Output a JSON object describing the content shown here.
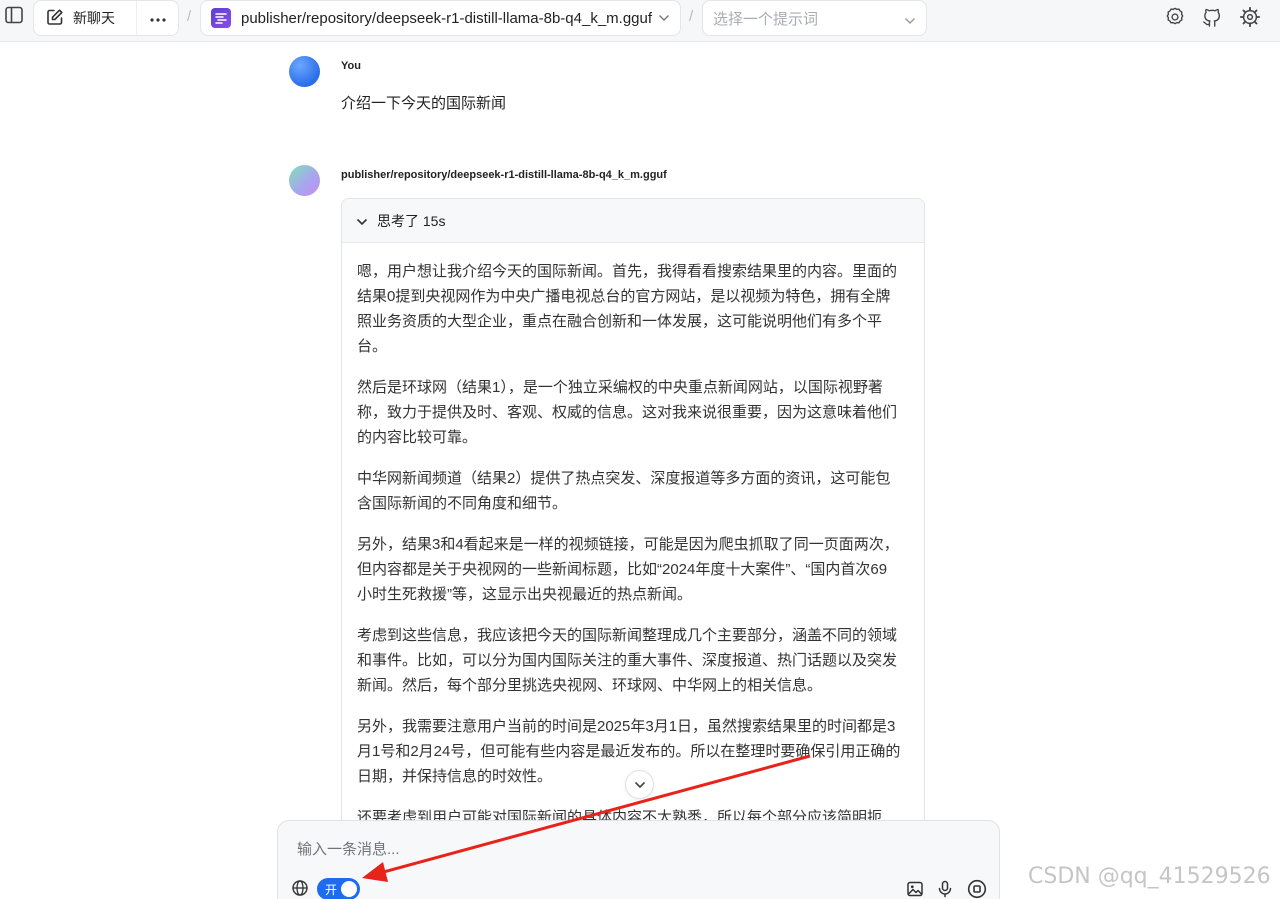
{
  "topbar": {
    "new_chat_label": "新聊天",
    "model_name": "publisher/repository/deepseek-r1-distill-llama-8b-q4_k_m.gguf",
    "prompt_placeholder": "选择一个提示词"
  },
  "icons": {
    "sidebar": "sidebar-toggle-icon",
    "new_chat": "edit-icon",
    "more": "more-horizontal-icon",
    "model": "model-logo-icon",
    "settings_a": "settings-gear-icon",
    "github": "github-icon",
    "settings_b": "settings-cog-icon"
  },
  "messages": {
    "user": {
      "sender": "You",
      "text": "介绍一下今天的国际新闻"
    },
    "assistant": {
      "sender": "publisher/repository/deepseek-r1-distill-llama-8b-q4_k_m.gguf",
      "thinking_label": "思考了 15s",
      "thinking_paragraphs": [
        "嗯，用户想让我介绍今天的国际新闻。首先，我得看看搜索结果里的内容。里面的结果0提到央视网作为中央广播电视总台的官方网站，是以视频为特色，拥有全牌照业务资质的大型企业，重点在融合创新和一体发展，这可能说明他们有多个平台。",
        "然后是环球网（结果1），是一个独立采编权的中央重点新闻网站，以国际视野著称，致力于提供及时、客观、权威的信息。这对我来说很重要，因为这意味着他们的内容比较可靠。",
        "中华网新闻频道（结果2）提供了热点突发、深度报道等多方面的资讯，这可能包含国际新闻的不同角度和细节。",
        "另外，结果3和4看起来是一样的视频链接，可能是因为爬虫抓取了同一页面两次，但内容都是关于央视网的一些新闻标题，比如“2024年度十大案件”、“国内首次69小时生死救援”等，这显示出央视最近的热点新闻。",
        "考虑到这些信息，我应该把今天的国际新闻整理成几个主要部分，涵盖不同的领域和事件。比如，可以分为国内国际关注的重大事件、深度报道、热门话题以及突发新闻。然后，每个部分里挑选央视网、环球网、中华网上的相关信息。",
        "另外，我需要注意用户当前的时间是2025年3月1日，虽然搜索结果里的时间都是3月1号和2月24号，但可能有些内容是最近发布的。所以在整理时要确保引用正确的日期，并保持信息的时效性。",
        "还要考虑到用户可能对国际新闻的具体内容不太熟悉，所以每个部分应该简明扼要。"
      ]
    }
  },
  "input": {
    "placeholder": "输入一条消息...",
    "web_search_toggle_label": "开",
    "web_search_enabled": true
  },
  "watermark": "CSDN @qq_41529526",
  "colors": {
    "accent": "#1e6bf0",
    "annotation_arrow": "#e8231a"
  }
}
